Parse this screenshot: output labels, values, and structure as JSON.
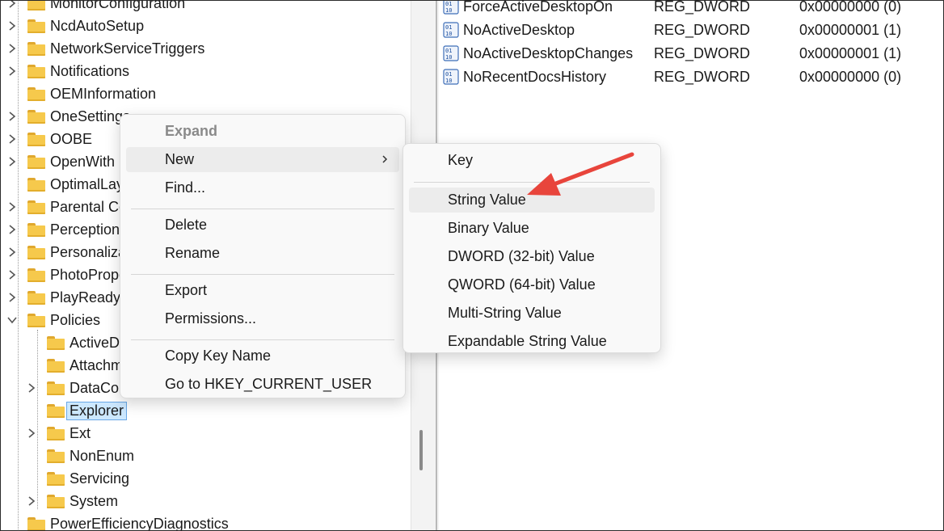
{
  "tree": {
    "items": [
      {
        "label": "MonitorConfiguration",
        "level": 0,
        "expander": "collapsed"
      },
      {
        "label": "NcdAutoSetup",
        "level": 0,
        "expander": "collapsed"
      },
      {
        "label": "NetworkServiceTriggers",
        "level": 0,
        "expander": "collapsed"
      },
      {
        "label": "Notifications",
        "level": 0,
        "expander": "collapsed"
      },
      {
        "label": "OEMInformation",
        "level": 0,
        "expander": "none"
      },
      {
        "label": "OneSettings",
        "level": 0,
        "expander": "collapsed"
      },
      {
        "label": "OOBE",
        "level": 0,
        "expander": "collapsed"
      },
      {
        "label": "OpenWith",
        "level": 0,
        "expander": "collapsed"
      },
      {
        "label": "OptimalLayout",
        "level": 0,
        "expander": "none"
      },
      {
        "label": "Parental Controls",
        "level": 0,
        "expander": "collapsed"
      },
      {
        "label": "Perception",
        "level": 0,
        "expander": "collapsed"
      },
      {
        "label": "Personalization",
        "level": 0,
        "expander": "collapsed"
      },
      {
        "label": "PhotoPropertyHandler",
        "level": 0,
        "expander": "collapsed"
      },
      {
        "label": "PlayReady",
        "level": 0,
        "expander": "collapsed"
      },
      {
        "label": "Policies",
        "level": 0,
        "expander": "expanded"
      },
      {
        "label": "ActiveDesktop",
        "level": 1,
        "expander": "none"
      },
      {
        "label": "Attachments",
        "level": 1,
        "expander": "none"
      },
      {
        "label": "DataCollection",
        "level": 1,
        "expander": "collapsed"
      },
      {
        "label": "Explorer",
        "level": 1,
        "expander": "none",
        "selected": true
      },
      {
        "label": "Ext",
        "level": 1,
        "expander": "collapsed"
      },
      {
        "label": "NonEnum",
        "level": 1,
        "expander": "none"
      },
      {
        "label": "Servicing",
        "level": 1,
        "expander": "none"
      },
      {
        "label": "System",
        "level": 1,
        "expander": "collapsed"
      },
      {
        "label": "PowerEfficiencyDiagnostics",
        "level": 0,
        "expander": "none"
      }
    ]
  },
  "values_pane": {
    "rows": [
      {
        "name": "ForceActiveDesktopOn",
        "type": "REG_DWORD",
        "data": "0x00000000 (0)"
      },
      {
        "name": "NoActiveDesktop",
        "type": "REG_DWORD",
        "data": "0x00000001 (1)"
      },
      {
        "name": "NoActiveDesktopChanges",
        "type": "REG_DWORD",
        "data": "0x00000001 (1)"
      },
      {
        "name": "NoRecentDocsHistory",
        "type": "REG_DWORD",
        "data": "0x00000000 (0)"
      }
    ]
  },
  "context_menu": {
    "items": [
      {
        "label": "Expand",
        "disabled": true
      },
      {
        "label": "New",
        "submenu": true,
        "highlighted": true
      },
      {
        "label": "Find..."
      },
      {
        "separator": true
      },
      {
        "label": "Delete"
      },
      {
        "label": "Rename"
      },
      {
        "separator": true
      },
      {
        "label": "Export"
      },
      {
        "label": "Permissions..."
      },
      {
        "separator": true
      },
      {
        "label": "Copy Key Name"
      },
      {
        "label": "Go to HKEY_CURRENT_USER"
      }
    ]
  },
  "new_submenu": {
    "items": [
      {
        "label": "Key"
      },
      {
        "separator": true
      },
      {
        "label": "String Value",
        "highlighted": true
      },
      {
        "label": "Binary Value"
      },
      {
        "label": "DWORD (32-bit) Value"
      },
      {
        "label": "QWORD (64-bit) Value"
      },
      {
        "label": "Multi-String Value"
      },
      {
        "label": "Expandable String Value"
      }
    ]
  },
  "annotation": {
    "icon": "red-arrow-icon",
    "color": "#e8453c",
    "points_to": "String Value"
  },
  "colors": {
    "folder": "#f6c94c",
    "selection": "#cce8ff",
    "menu_bg": "#f9f9f9",
    "menu_hover": "#ececec"
  }
}
